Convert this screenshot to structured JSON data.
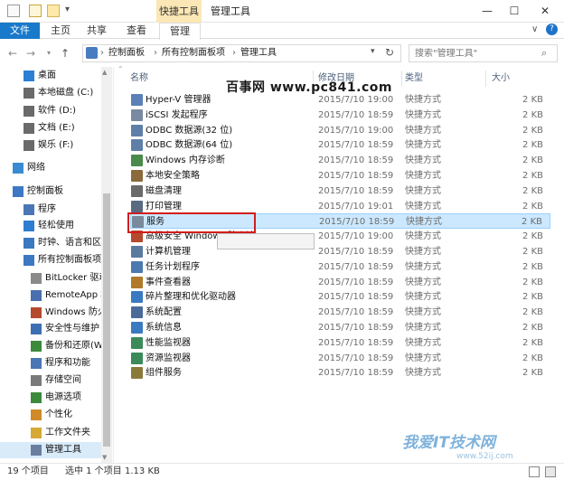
{
  "titlebar": {
    "context_tab": "快捷工具",
    "title": "管理工具",
    "minimize": "—",
    "maximize": "☐",
    "close": "✕"
  },
  "ribbon": {
    "file": "文件",
    "home": "主页",
    "share": "共享",
    "view": "查看",
    "manage": "管理",
    "collapse": "∨",
    "help": "?"
  },
  "address": {
    "back": "←",
    "forward": "→",
    "up": "↑",
    "breadcrumbs": [
      "控制面板",
      "所有控制面板项",
      "管理工具"
    ],
    "separator": "›",
    "search_placeholder": "搜索\"管理工具\""
  },
  "sidebar": {
    "items": [
      {
        "label": "桌面",
        "icon": "desktop-icon",
        "color": "#2d7fd4"
      },
      {
        "label": "本地磁盘 (C:)",
        "icon": "drive-icon",
        "color": "#6a6a6a"
      },
      {
        "label": "软件 (D:)",
        "icon": "drive-icon",
        "color": "#6a6a6a"
      },
      {
        "label": "文档 (E:)",
        "icon": "drive-icon",
        "color": "#6a6a6a"
      },
      {
        "label": "娱乐 (F:)",
        "icon": "drive-icon",
        "color": "#6a6a6a"
      },
      {
        "label": "网络",
        "icon": "network-icon",
        "color": "#3a8bd0"
      },
      {
        "label": "控制面板",
        "icon": "control-panel-icon",
        "color": "#3c79c2"
      },
      {
        "label": "程序",
        "icon": "programs-icon",
        "color": "#4a76b5"
      },
      {
        "label": "轻松使用",
        "icon": "ease-of-access-icon",
        "color": "#2f7dd1"
      },
      {
        "label": "时钟、语言和区",
        "icon": "clock-icon",
        "color": "#3b78c0"
      },
      {
        "label": "所有控制面板项",
        "icon": "all-items-icon",
        "color": "#3c79c2"
      },
      {
        "label": "BitLocker 驱动",
        "icon": "bitlocker-icon",
        "color": "#8a8a8a"
      },
      {
        "label": "RemoteApp 和",
        "icon": "remoteapp-icon",
        "color": "#4a6fae"
      },
      {
        "label": "Windows 防火",
        "icon": "firewall-icon",
        "color": "#b44a2e"
      },
      {
        "label": "安全性与维护",
        "icon": "flag-icon",
        "color": "#3d6fb3"
      },
      {
        "label": "备份和还原(Wi",
        "icon": "backup-icon",
        "color": "#3c8a3c"
      },
      {
        "label": "程序和功能",
        "icon": "programs-features-icon",
        "color": "#4a76b5"
      },
      {
        "label": "存储空间",
        "icon": "storage-icon",
        "color": "#7a7a7a"
      },
      {
        "label": "电源选项",
        "icon": "power-icon",
        "color": "#3c8a3c"
      },
      {
        "label": "个性化",
        "icon": "personalize-icon",
        "color": "#d08a2a"
      },
      {
        "label": "工作文件夹",
        "icon": "work-folder-icon",
        "color": "#d6a935"
      },
      {
        "label": "管理工具",
        "icon": "admin-tools-icon",
        "color": "#6a7fa0"
      }
    ]
  },
  "columns": {
    "name": "名称",
    "date": "修改日期",
    "type": "类型",
    "size": "大小"
  },
  "files": [
    {
      "name": "Hyper-V 管理器",
      "date": "2015/7/10 19:00",
      "type": "快捷方式",
      "size": "2 KB",
      "icon": "hyperv-icon",
      "color": "#5b7fb7"
    },
    {
      "name": "iSCSI 发起程序",
      "date": "2015/7/10 18:59",
      "type": "快捷方式",
      "size": "2 KB",
      "icon": "iscsi-icon",
      "color": "#7a8aa0"
    },
    {
      "name": "ODBC 数据源(32 位)",
      "date": "2015/7/10 19:00",
      "type": "快捷方式",
      "size": "2 KB",
      "icon": "odbc-icon",
      "color": "#5f7fa8"
    },
    {
      "name": "ODBC 数据源(64 位)",
      "date": "2015/7/10 18:59",
      "type": "快捷方式",
      "size": "2 KB",
      "icon": "odbc-icon",
      "color": "#5f7fa8"
    },
    {
      "name": "Windows 内存诊断",
      "date": "2015/7/10 18:59",
      "type": "快捷方式",
      "size": "2 KB",
      "icon": "memory-diagnostic-icon",
      "color": "#4a8a4a"
    },
    {
      "name": "本地安全策略",
      "date": "2015/7/10 18:59",
      "type": "快捷方式",
      "size": "2 KB",
      "icon": "security-policy-icon",
      "color": "#8a6a3a"
    },
    {
      "name": "磁盘清理",
      "date": "2015/7/10 18:59",
      "type": "快捷方式",
      "size": "2 KB",
      "icon": "disk-cleanup-icon",
      "color": "#6a6a6a"
    },
    {
      "name": "打印管理",
      "date": "2015/7/10 19:01",
      "type": "快捷方式",
      "size": "2 KB",
      "icon": "print-icon",
      "color": "#5a6a80"
    },
    {
      "name": "服务",
      "date": "2015/7/10 18:59",
      "type": "快捷方式",
      "size": "2 KB",
      "icon": "services-icon",
      "color": "#7a8a9a"
    },
    {
      "name": "高级安全 Windows 防火墙",
      "date": "2015/7/10 19:00",
      "type": "快捷方式",
      "size": "2 KB",
      "icon": "firewall-icon",
      "color": "#b44a2e"
    },
    {
      "name": "计算机管理",
      "date": "2015/7/10 18:59",
      "type": "快捷方式",
      "size": "2 KB",
      "icon": "computer-management-icon",
      "color": "#5a7aa0"
    },
    {
      "name": "任务计划程序",
      "date": "2015/7/10 18:59",
      "type": "快捷方式",
      "size": "2 KB",
      "icon": "task-scheduler-icon",
      "color": "#4a7ab0"
    },
    {
      "name": "事件查看器",
      "date": "2015/7/10 18:59",
      "type": "快捷方式",
      "size": "2 KB",
      "icon": "event-viewer-icon",
      "color": "#b07a2a"
    },
    {
      "name": "碎片整理和优化驱动器",
      "date": "2015/7/10 18:59",
      "type": "快捷方式",
      "size": "2 KB",
      "icon": "defrag-icon",
      "color": "#3a7ac0"
    },
    {
      "name": "系统配置",
      "date": "2015/7/10 18:59",
      "type": "快捷方式",
      "size": "2 KB",
      "icon": "system-config-icon",
      "color": "#4a6a9a"
    },
    {
      "name": "系统信息",
      "date": "2015/7/10 18:59",
      "type": "快捷方式",
      "size": "2 KB",
      "icon": "system-info-icon",
      "color": "#3a7ac0"
    },
    {
      "name": "性能监视器",
      "date": "2015/7/10 18:59",
      "type": "快捷方式",
      "size": "2 KB",
      "icon": "performance-icon",
      "color": "#3a8a5a"
    },
    {
      "name": "资源监视器",
      "date": "2015/7/10 18:59",
      "type": "快捷方式",
      "size": "2 KB",
      "icon": "resource-monitor-icon",
      "color": "#3a8a5a"
    },
    {
      "name": "组件服务",
      "date": "2015/7/10 18:59",
      "type": "快捷方式",
      "size": "2 KB",
      "icon": "component-services-icon",
      "color": "#8a7a3a"
    }
  ],
  "selected_index": 8,
  "watermarks": {
    "top": "百事网 www.pc841.com",
    "bottom": "我爱IT技术网",
    "bottom_url": "www.52ij.com"
  },
  "status": {
    "count": "19 个项目",
    "selection": "选中 1 个项目",
    "size": "1.13 KB"
  }
}
